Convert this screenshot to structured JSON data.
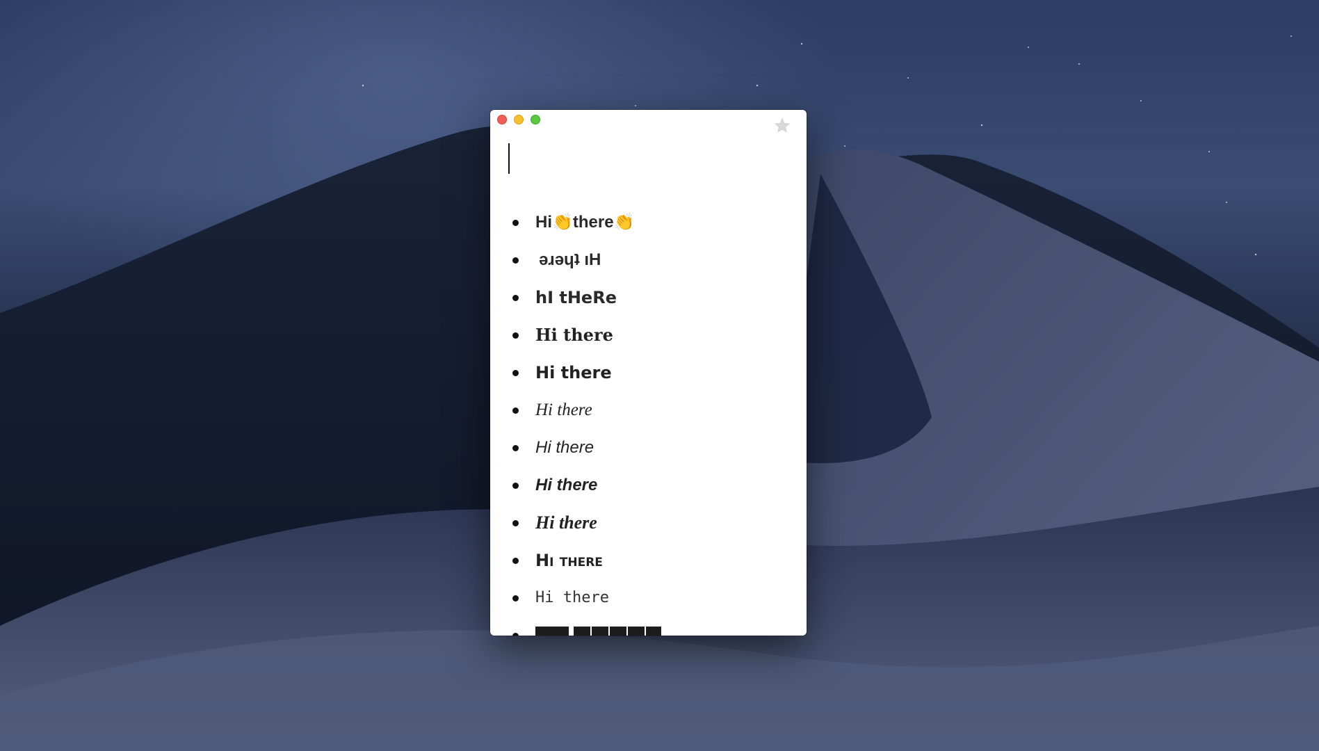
{
  "window": {
    "buttons": {
      "close": "close",
      "minimize": "minimize",
      "zoom": "zoom"
    },
    "favorite_icon": "star-icon"
  },
  "input": {
    "value": ""
  },
  "results": [
    {
      "text": "Hi👏there👏",
      "style": "clap"
    },
    {
      "text": "ǝɹǝɥʇ ıH",
      "style": "upside-down"
    },
    {
      "text": "hI tHeRe",
      "style": "alternating-case"
    },
    {
      "text": "Hi there",
      "style": "serif-bold"
    },
    {
      "text": "Hi there",
      "style": "sans-bold"
    },
    {
      "text": "Hi there",
      "style": "serif-italic"
    },
    {
      "text": "Hi there",
      "style": "sans-italic"
    },
    {
      "text": "Hi there",
      "style": "sans-bold-italic"
    },
    {
      "text": "Hi there",
      "style": "serif-bold-italic"
    },
    {
      "text": "Hi there",
      "style": "small-caps"
    },
    {
      "text": "Hi there",
      "style": "monospace"
    },
    {
      "text": "",
      "style": "squared-negative"
    }
  ],
  "colors": {
    "close": "#ee5f57",
    "minimize": "#f7be30",
    "zoom": "#5bc83f",
    "window_bg": "#ffffff",
    "text": "#222222"
  }
}
